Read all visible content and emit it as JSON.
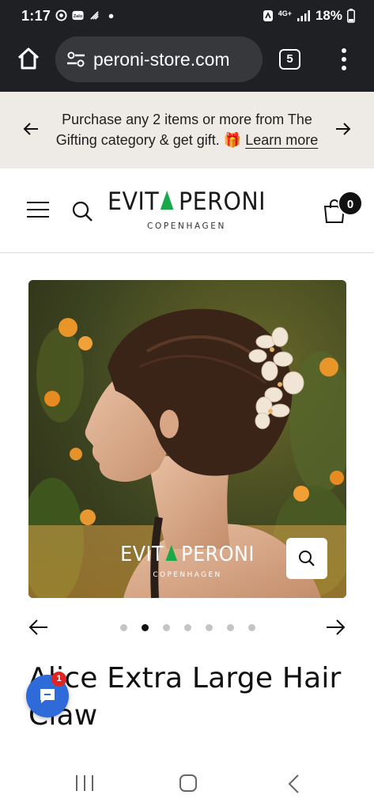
{
  "status_bar": {
    "time": "1:17",
    "app_icons": [
      "chrome-icon",
      "zalo-icon",
      "wifi-calling-icon",
      "dot-icon"
    ],
    "network": "4G+",
    "battery": "18%",
    "zalo_label": "Zalo"
  },
  "browser": {
    "url": "peroni-store.com",
    "tab_count": "5"
  },
  "announcement": {
    "text": "Purchase any 2 items or more from The Gifting category & get gift. 🎁",
    "link": "Learn more"
  },
  "header": {
    "logo_left": "EVIT",
    "logo_right": "PERONI",
    "logo_sub": "COPENHAGEN",
    "cart_count": "0",
    "brand_color": "#19a84a"
  },
  "product_image": {
    "logo_left": "EVIT",
    "logo_right": "PERONI",
    "logo_sub": "COPENHAGEN",
    "alt": "Woman wearing flower hair claw"
  },
  "carousel": {
    "dot_count": 7,
    "active_index": 1
  },
  "product": {
    "title": "Alice Extra Large Hair Claw"
  },
  "chat": {
    "unread": "1",
    "color": "#2f6bd8"
  }
}
